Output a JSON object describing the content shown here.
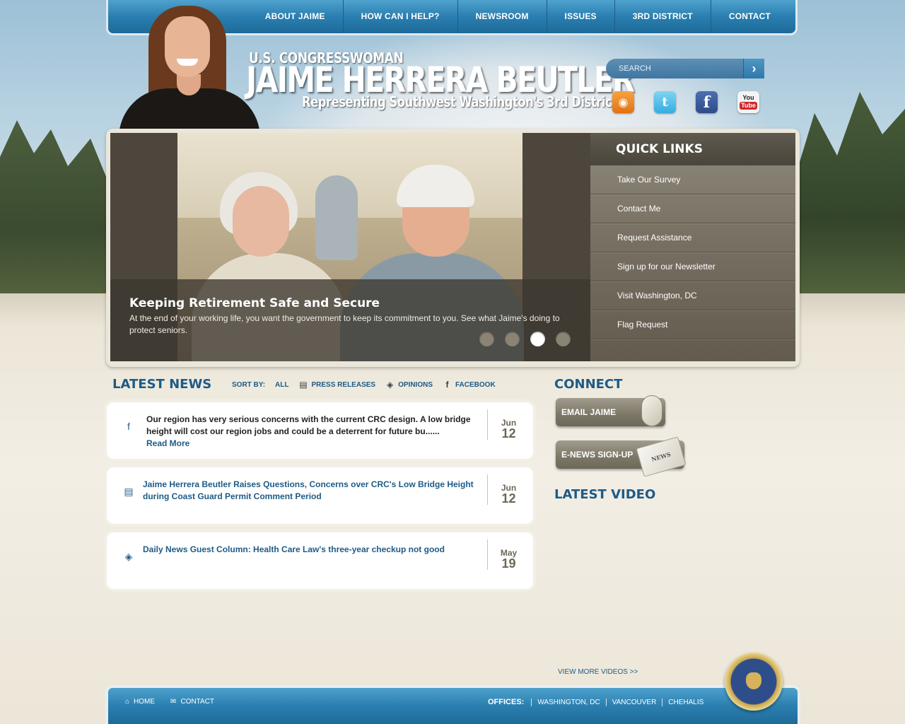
{
  "nav": {
    "items": [
      "ABOUT JAIME",
      "HOW CAN I HELP?",
      "NEWSROOM",
      "ISSUES",
      "3RD DISTRICT",
      "CONTACT"
    ]
  },
  "header": {
    "title_small": "U.S. CONGRESSWOMAN",
    "title_name": "JAIME HERRERA BEUTLER",
    "title_sub": "Representing Southwest Washington's 3rd District"
  },
  "search": {
    "placeholder": "SEARCH"
  },
  "social": {
    "icons": [
      "rss-icon",
      "twitter-icon",
      "facebook-icon",
      "youtube-icon"
    ],
    "youtube_top": "You",
    "youtube_bottom": "Tube"
  },
  "slider": {
    "title": "Keeping Retirement Safe and Secure",
    "text": "At the end of your working life, you want the government to keep its commitment to you. See what Jaime's doing to protect seniors.",
    "slide_count": 4,
    "active_index": 3
  },
  "quick_links": {
    "title": "QUICK LINKS",
    "items": [
      "Take Our Survey",
      "Contact Me",
      "Request Assistance",
      "Sign up for our Newsletter",
      "Visit Washington, DC",
      "Flag Request"
    ]
  },
  "news": {
    "title": "LATEST NEWS",
    "sort_label": "SORT BY:",
    "sort_all": "ALL",
    "sort_press": "PRESS RELEASES",
    "sort_opinions": "OPINIONS",
    "sort_facebook": "FACEBOOK",
    "items": [
      {
        "text": "Our region has very serious concerns with the current CRC design. A low bridge height will cost our region jobs and could be a deterrent for future bu......",
        "link": "Read More",
        "month": "Jun",
        "day": "12",
        "icon": "facebook-icon"
      },
      {
        "text": "Jaime Herrera Beutler Raises Questions, Concerns over CRC's Low Bridge Height during Coast Guard Permit Comment Period",
        "month": "Jun",
        "day": "12",
        "icon": "press-release-icon"
      },
      {
        "text": "Daily News Guest Column: Health Care Law's three-year checkup not good",
        "month": "May",
        "day": "19",
        "icon": "opinion-icon"
      }
    ]
  },
  "connect": {
    "title": "CONNECT",
    "email_label": "EMAIL JAIME",
    "enews_label": "E-NEWS SIGN-UP",
    "enews_art": "NEWS",
    "video_title": "LATEST VIDEO",
    "more_videos": "VIEW MORE VIDEOS >>"
  },
  "footer": {
    "home": "HOME",
    "contact": "CONTACT",
    "offices_label": "OFFICES:",
    "offices": [
      "WASHINGTON, DC",
      "VANCOUVER",
      "CHEHALIS"
    ]
  }
}
